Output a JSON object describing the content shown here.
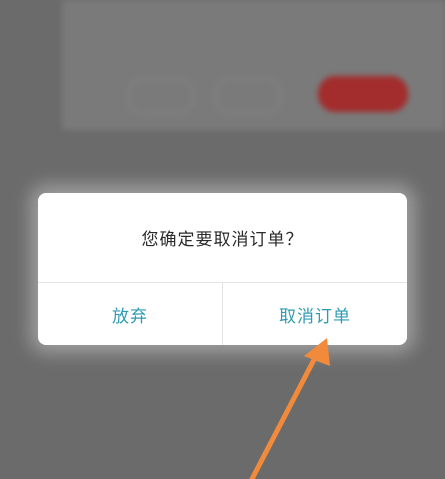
{
  "background": {
    "top_text_1": "",
    "top_text_2": "",
    "button_1": "",
    "button_2": "",
    "button_3": "",
    "notice_text": "",
    "notice_link": ""
  },
  "dialog": {
    "message": "您确定要取消订单？",
    "cancel_label": "放弃",
    "confirm_label": "取消订单"
  },
  "colors": {
    "dialog_button_text": "#2f9bb3",
    "overlay": "#6b6b6b",
    "annotation_arrow": "#f28a3c"
  },
  "annotation": {
    "icon": "arrow-pointer-icon"
  }
}
